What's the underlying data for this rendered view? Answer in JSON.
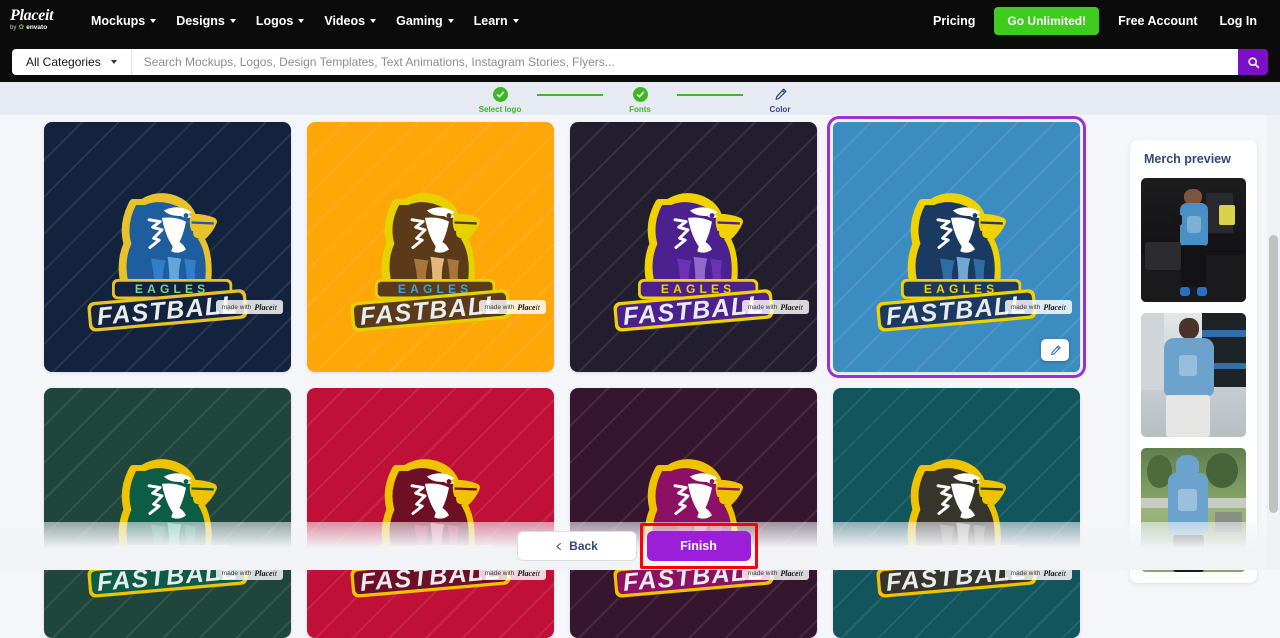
{
  "header": {
    "brand": {
      "name_main": "Place",
      "name_italic": "it",
      "byline_pre": "by",
      "byline_brand": "envato"
    },
    "nav_items": [
      {
        "label": "Mockups",
        "icon": "chevron-down-icon"
      },
      {
        "label": "Designs",
        "icon": "chevron-down-icon"
      },
      {
        "label": "Logos",
        "icon": "chevron-down-icon"
      },
      {
        "label": "Videos",
        "icon": "chevron-down-icon"
      },
      {
        "label": "Gaming",
        "icon": "chevron-down-icon"
      },
      {
        "label": "Learn",
        "icon": "chevron-down-icon"
      }
    ],
    "pricing_label": "Pricing",
    "go_unlimited_label": "Go Unlimited!",
    "free_account_label": "Free Account",
    "log_in_label": "Log In",
    "accent_green": "#3fcc1f",
    "accent_purple": "#7b11c4"
  },
  "search": {
    "category_label": "All Categories",
    "placeholder": "Search Mockups, Logos, Design Templates, Text Animations, Instagram Stories, Flyers...",
    "value": "",
    "icon": "search-icon"
  },
  "stepper": {
    "steps": [
      {
        "label": "Select logo",
        "state": "done",
        "icon": "check-circle-icon"
      },
      {
        "label": "Fonts",
        "state": "done",
        "icon": "check-circle-icon"
      },
      {
        "label": "Color",
        "state": "active",
        "icon": "brush-icon"
      }
    ],
    "done_color": "#3fb527",
    "active_color": "#2f4a7a"
  },
  "logo": {
    "text_top": "EAGLES",
    "text_bottom": "FASTBALL",
    "watermark_pre": "made with",
    "watermark_brand": "Place",
    "watermark_brand_it": "it"
  },
  "grid": {
    "cards": [
      {
        "name": "navy-blue",
        "bg": "#14233d",
        "outline": "#e8c22a",
        "body_dark": "#1f5e9e",
        "body_mid": "#2f80c6",
        "body_light": "#5fa8dd",
        "text_top_color": "#6fd98f",
        "plate": "#14233d",
        "selected": false
      },
      {
        "name": "orange-brown",
        "bg": "#ffa608",
        "outline": "#e6d200",
        "body_dark": "#5a3a19",
        "body_mid": "#a8763c",
        "body_light": "#e3b679",
        "text_top_color": "#3ba3e0",
        "plate": "#5a3a19",
        "selected": false
      },
      {
        "name": "dark-purple",
        "bg": "#231e2e",
        "outline": "#f0d200",
        "body_dark": "#4c208f",
        "body_mid": "#6a32b5",
        "body_light": "#9268cf",
        "text_top_color": "#f0d200",
        "plate": "#4c208f",
        "selected": false
      },
      {
        "name": "steel-blue",
        "bg": "#3b8cc0",
        "outline": "#f0d200",
        "body_dark": "#1b3a62",
        "body_mid": "#2e6da4",
        "body_light": "#6fa8d0",
        "text_top_color": "#f0d200",
        "plate": "#1b3a62",
        "selected": true
      },
      {
        "name": "dark-green",
        "bg": "#1f453c",
        "outline": "#f0c300",
        "body_dark": "#0d5c46",
        "body_mid": "#1d8a6a",
        "body_light": "#4fc0a0",
        "text_top_color": "#f0c300",
        "plate": "#0d5c46",
        "selected": false
      },
      {
        "name": "crimson-red",
        "bg": "#c11038",
        "outline": "#f0c300",
        "body_dark": "#6d1026",
        "body_mid": "#b52048",
        "body_light": "#e06a8a",
        "text_top_color": "#f0c300",
        "plate": "#6d1026",
        "selected": false
      },
      {
        "name": "plum-magenta",
        "bg": "#36152f",
        "outline": "#f0c300",
        "body_dark": "#8c1063",
        "body_mid": "#b42a86",
        "body_light": "#d95cb0",
        "text_top_color": "#f0c300",
        "plate": "#8c1063",
        "selected": false
      },
      {
        "name": "teal-olive",
        "bg": "#12555c",
        "outline": "#f0c300",
        "body_dark": "#36342b",
        "body_mid": "#6d6a57",
        "body_light": "#a8a392",
        "text_top_color": "#f0c300",
        "plate": "#36342b",
        "selected": false
      }
    ],
    "edit_icon": "pencil-icon",
    "selected_border_color": "#9b2fd8"
  },
  "merch": {
    "title": "Merch preview",
    "items": [
      {
        "name": "woman-lifting-dumbbell-tshirt",
        "garment": "#4a90c4",
        "scene": "#141416"
      },
      {
        "name": "man-in-hoodie-gym",
        "garment": "#6ba3cc",
        "scene": "#cfd6d8"
      },
      {
        "name": "man-back-hoodie-outdoors",
        "garment": "#6ba3cc",
        "scene": "#7fa46a"
      }
    ]
  },
  "footer": {
    "back_label": "Back",
    "back_icon": "chevron-left-icon",
    "finish_label": "Finish",
    "finish_color": "#9b1fd8",
    "highlight_color": "#ff0000"
  }
}
